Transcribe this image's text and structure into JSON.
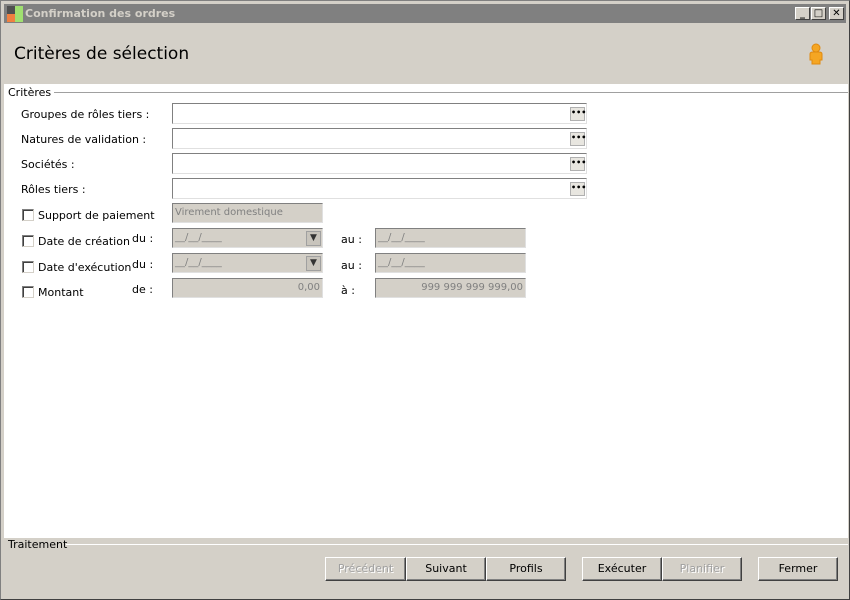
{
  "window": {
    "title": "Confirmation des ordres",
    "minimize": "_",
    "maximize": "□",
    "close": "✕"
  },
  "header": {
    "title": "Critères de sélection",
    "user_icon": "user-icon"
  },
  "criteria": {
    "legend": "Critères",
    "groupes_label": "Groupes de rôles tiers :",
    "natures_label": "Natures de validation :",
    "societes_label": "Sociétés :",
    "roles_label": "Rôles tiers :",
    "browse": "•••",
    "support_label": "Support de paiement",
    "support_value": "Virement domestique",
    "creation_label": "Date de création",
    "execution_label": "Date d'exécution",
    "montant_label": "Montant",
    "du": "du :",
    "au": "au :",
    "de": "de :",
    "a": "à :",
    "date_mask": "__/__/____",
    "montant_from": "0,00",
    "montant_to": "999 999 999 999,00"
  },
  "footer": {
    "legend": "Traitement",
    "buttons": [
      "Précédent",
      "Suivant",
      "Profils",
      "Exécuter",
      "Planifier",
      "Fermer"
    ]
  }
}
